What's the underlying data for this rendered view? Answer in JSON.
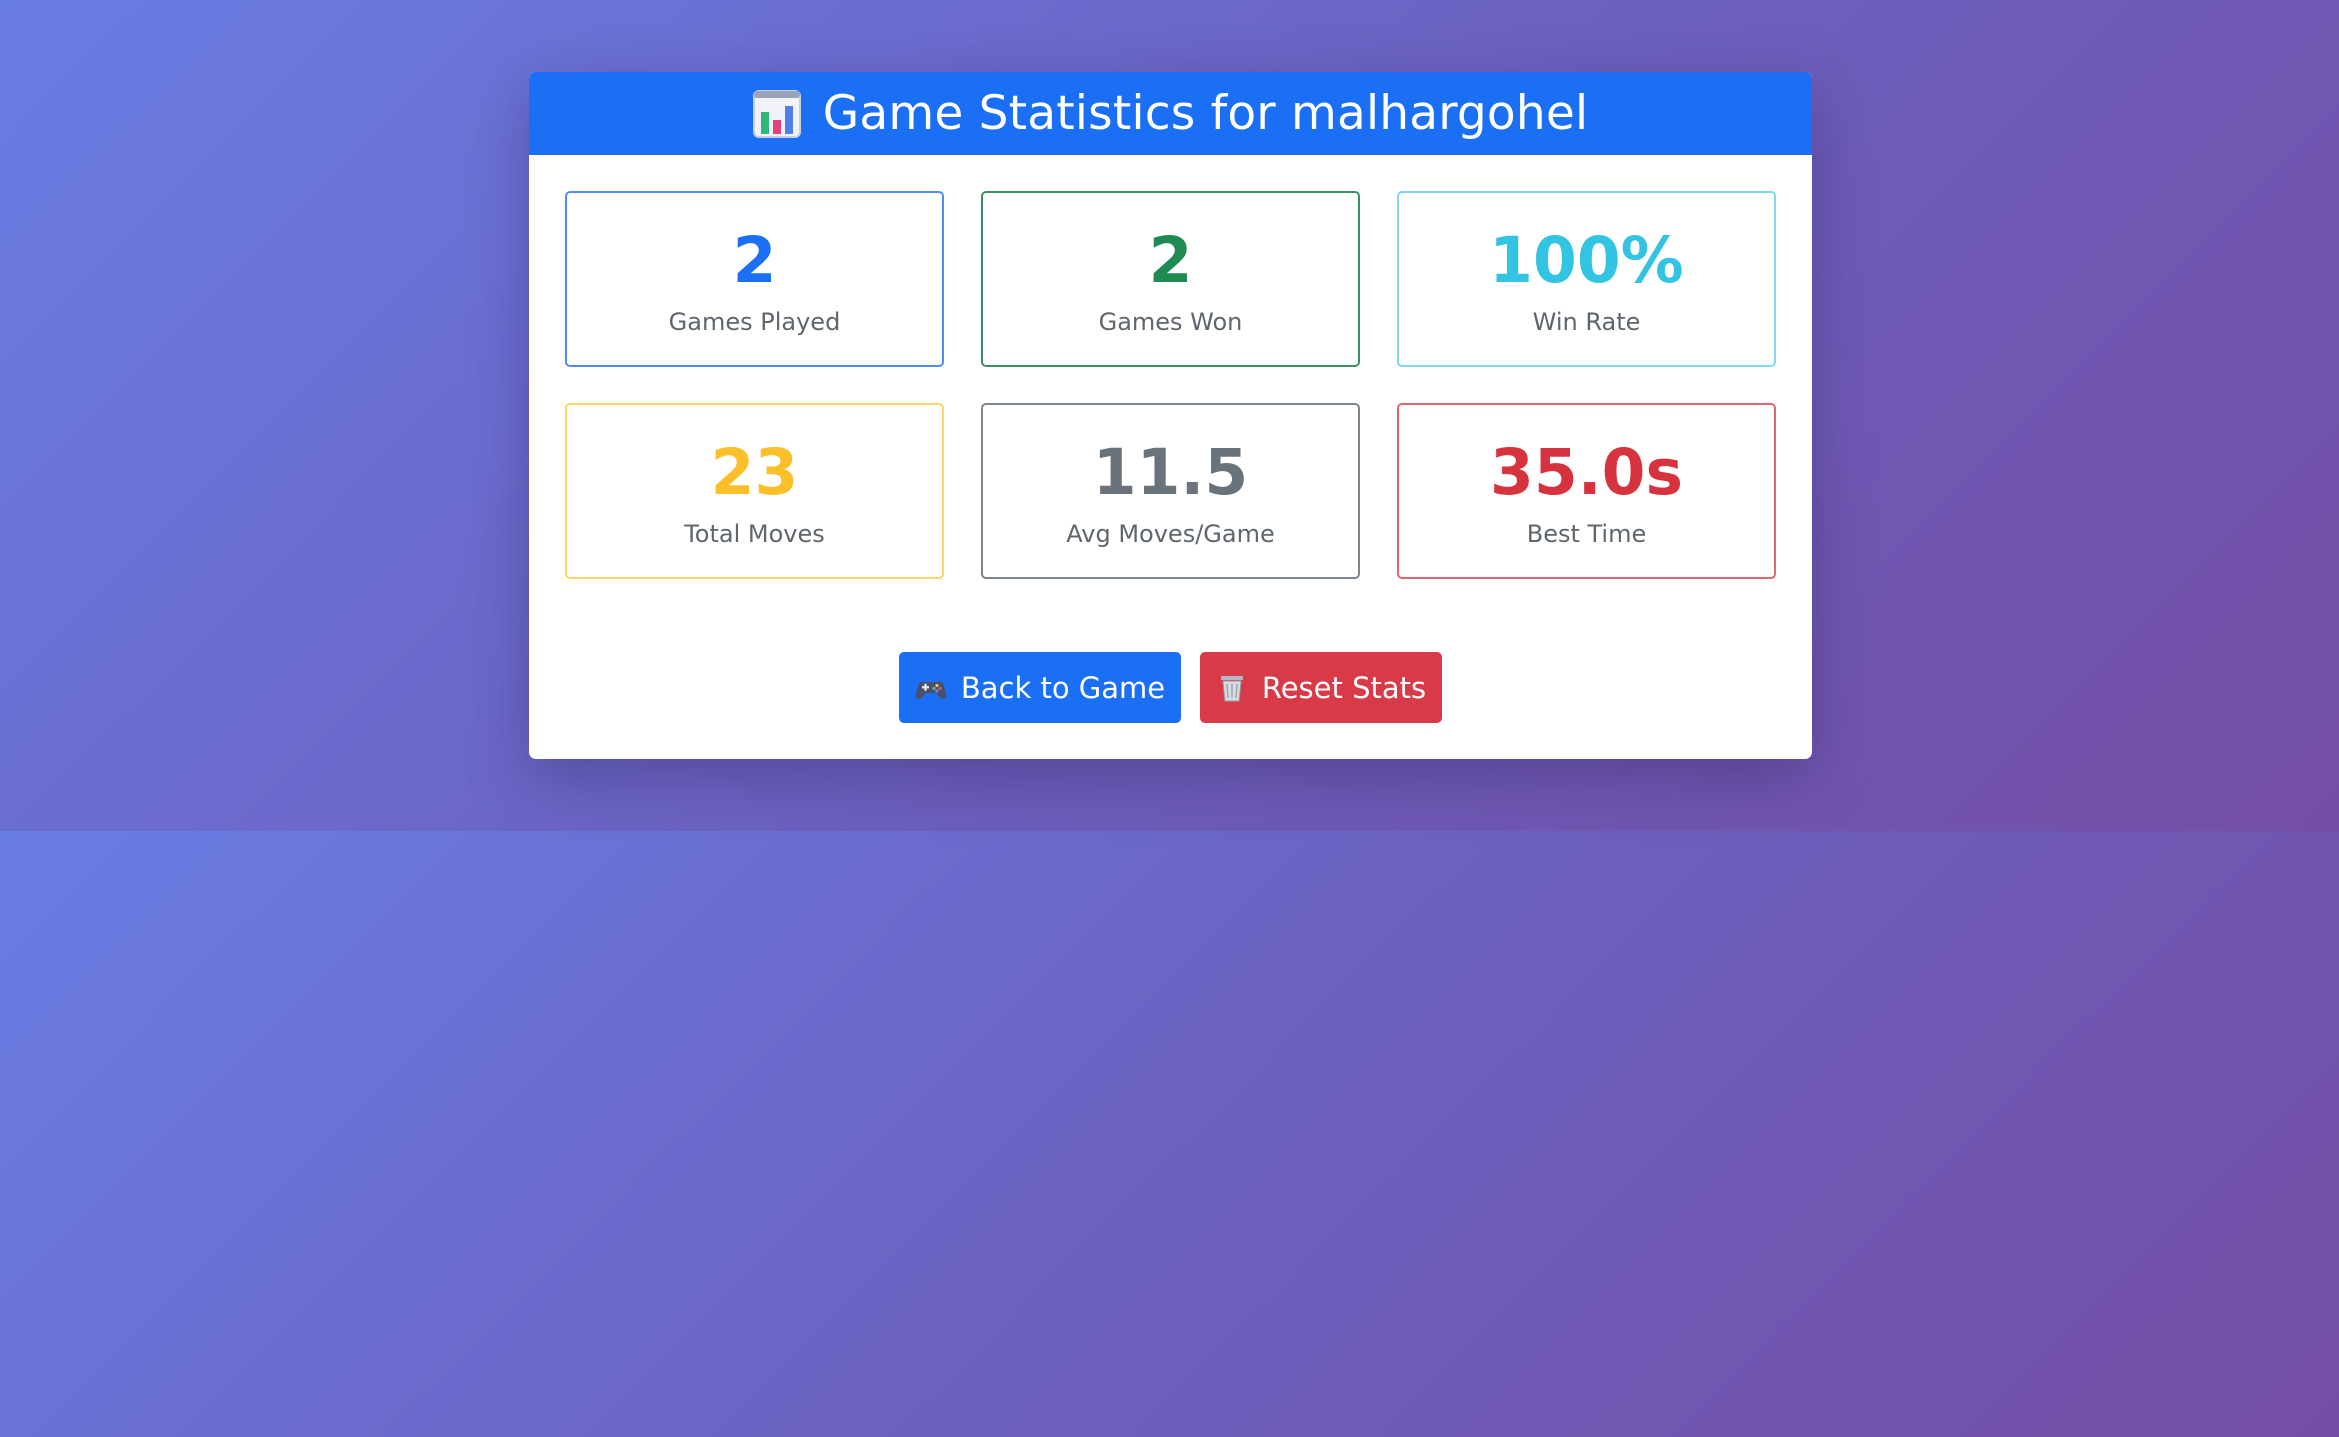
{
  "header": {
    "icon": "bar-chart-icon",
    "title": "Game Statistics for malhargohel"
  },
  "stats": [
    {
      "value": "2",
      "label": "Games Played",
      "color": "#1a6ff5"
    },
    {
      "value": "2",
      "label": "Games Won",
      "color": "#1f8a52"
    },
    {
      "value": "100%",
      "label": "Win Rate",
      "color": "#33c3e3"
    },
    {
      "value": "23",
      "label": "Total Moves",
      "color": "#fbbf29"
    },
    {
      "value": "11.5",
      "label": "Avg Moves/Game",
      "color": "#6a737b"
    },
    {
      "value": "35.0s",
      "label": "Best Time",
      "color": "#d6333f"
    }
  ],
  "buttons": {
    "back": {
      "label": "Back to Game",
      "icon": "game-controller-icon",
      "color": "#1a6ff5"
    },
    "reset": {
      "label": "Reset Stats",
      "icon": "wastebasket-icon",
      "color": "#d93a47"
    }
  }
}
